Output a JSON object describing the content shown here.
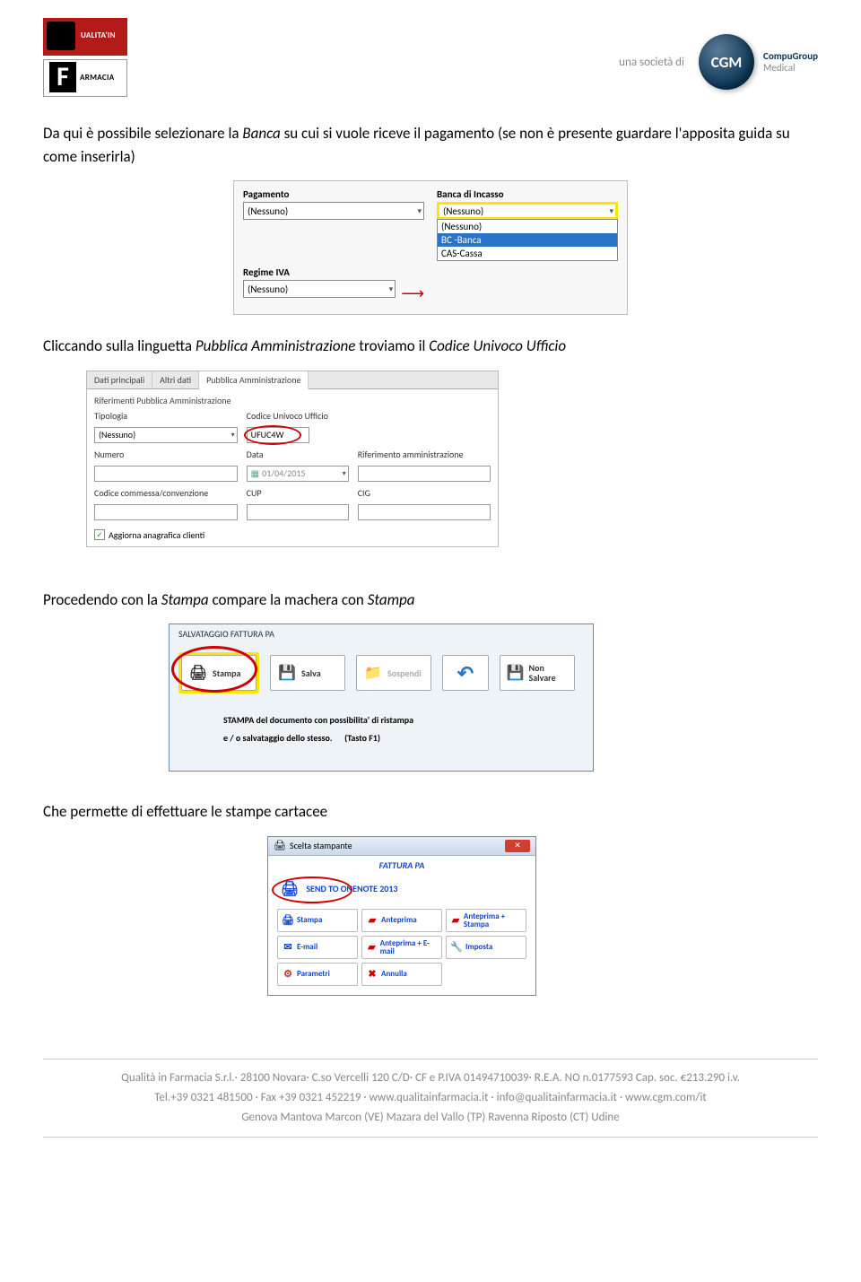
{
  "header": {
    "societa_di": "una società di",
    "cgm": "CGM",
    "cgm_line1": "CompuGroup",
    "cgm_line2": "Medical"
  },
  "para1_a": "Da qui è possibile selezionare la ",
  "para1_b": "Banca",
  "para1_c": " su cui si vuole riceve il pagamento (se non è presente guardare l'apposita guida su come inserirla)",
  "ss1": {
    "pagamento_lbl": "Pagamento",
    "pagamento_val": "(Nessuno)",
    "banca_lbl": "Banca di Incasso",
    "banca_val": "(Nessuno)",
    "regime_lbl": "Regime IVA",
    "regime_val": "(Nessuno)",
    "opts": [
      "(Nessuno)",
      "BC -Banca",
      "CAS-Cassa"
    ]
  },
  "para2_a": "Cliccando sulla linguetta ",
  "para2_b": "Pubblica Amministrazione",
  "para2_c": " troviamo il ",
  "para2_d": "Codice Univoco Ufficio",
  "ss2": {
    "tabs": [
      "Dati principali",
      "Altri dati",
      "Pubblica Amministrazione"
    ],
    "group_title": "Riferimenti Pubblica Amministrazione",
    "tipologia_lbl": "Tipologia",
    "tipologia_val": "(Nessuno)",
    "codice_lbl": "Codice Univoco Ufficio",
    "codice_val": "UFUC4W",
    "numero_lbl": "Numero",
    "data_lbl": "Data",
    "data_val": "01/04/2015",
    "rif_lbl": "Riferimento amministrazione",
    "commessa_lbl": "Codice commessa/convenzione",
    "cup_lbl": "CUP",
    "cig_lbl": "CIG",
    "chk_lbl": "Aggiorna anagrafica clienti"
  },
  "para3_a": "Procedendo con la ",
  "para3_b": "Stampa",
  "para3_c": " compare la machera con ",
  "para3_d": "Stampa",
  "ss3": {
    "title": "SALVATAGGIO FATTURA PA",
    "btns": [
      "Stampa",
      "Salva",
      "Sospendi",
      "",
      "Non Salvare"
    ],
    "desc1": "STAMPA del documento con possibilita' di ristampa",
    "desc2a": "e / o salvataggio dello stesso.",
    "desc2b": "(Tasto F1)"
  },
  "para4": "Che permette di effettuare le stampe cartacee",
  "ss4": {
    "window_title": "Scelta stampante",
    "fattura": "FATTURA PA",
    "printer": "SEND TO ONENOTE 2013",
    "opts": [
      "Stampa",
      "Anteprima",
      "Anteprima + Stampa",
      "E-mail",
      "Anteprima + E-mail",
      "Imposta",
      "Parametri",
      "Annulla"
    ]
  },
  "footer": {
    "l1": "Qualità in Farmacia S.r.l.· 28100 Novara· C.so Vercelli 120 C/D· CF e P.IVA 01494710039· R.E.A. NO n.0177593 Cap. soc. €213.290 i.v.",
    "l2": "Tel.+39 0321 481500 · Fax +39 0321 452219 · www.qualitainfarmacia.it · info@qualitainfarmacia.it · www.cgm.com/it",
    "l3": "Genova   Mantova   Marcon (VE)  Mazara del Vallo (TP)  Ravenna   Riposto (CT)   Udine"
  }
}
